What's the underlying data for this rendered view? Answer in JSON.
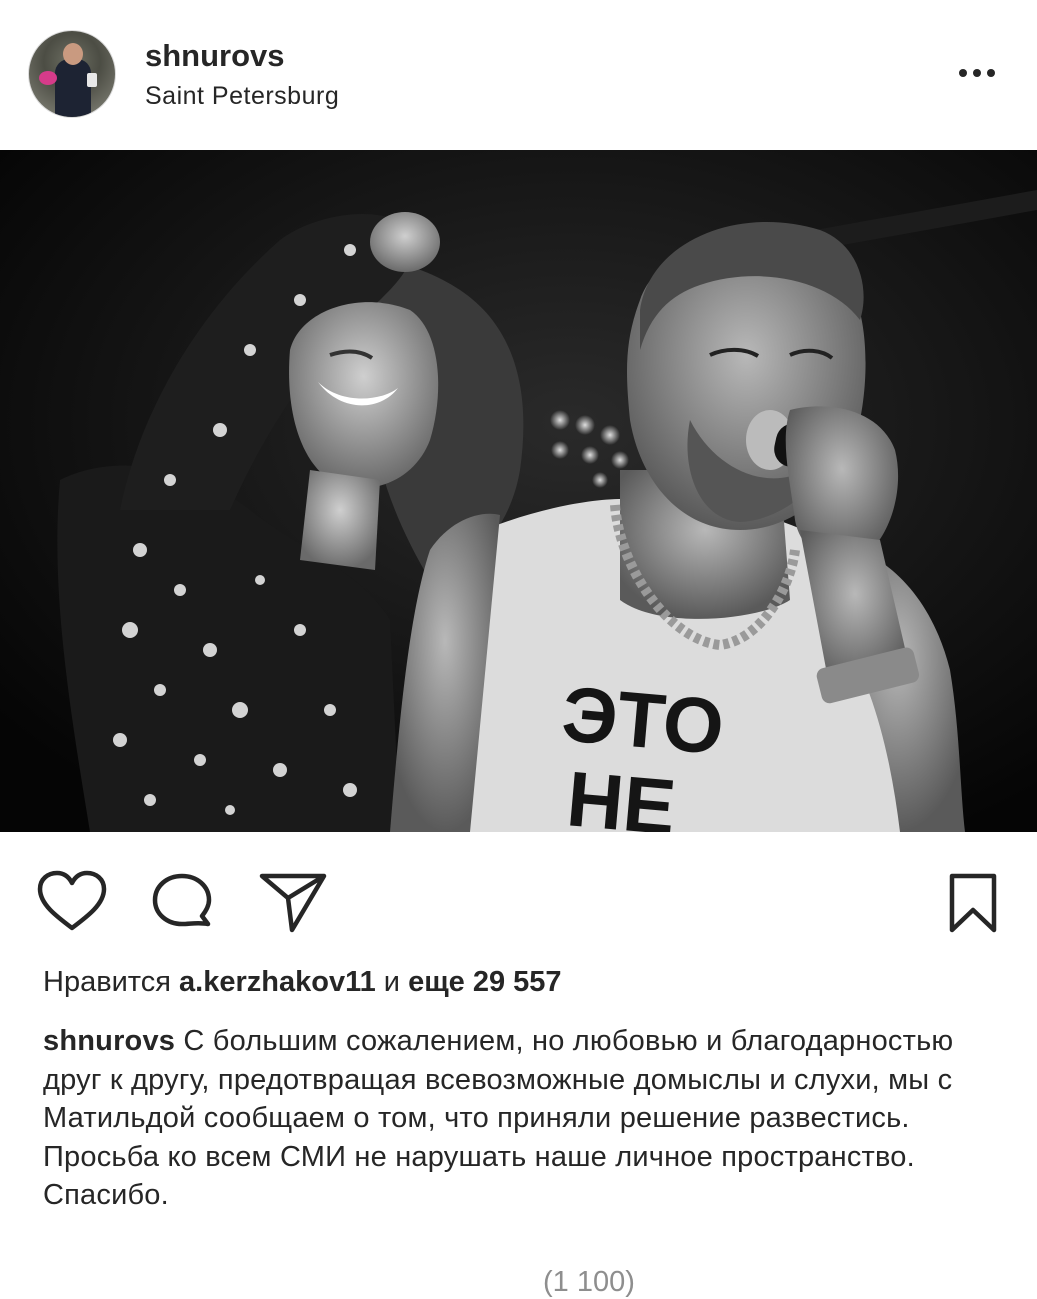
{
  "post": {
    "username": "shnurovs",
    "location": "Saint Petersburg",
    "photo_shirt_text_line1": "ЭТО",
    "photo_shirt_text_line2": "НЕ"
  },
  "likes": {
    "prefix": "Нравится",
    "user": "a.kerzhakov11",
    "middle": "и",
    "rest": "еще 29 557"
  },
  "caption": {
    "username": "shnurovs",
    "text": "С большим сожалением, но любовью и благодарностью друг к другу, предотвращая всевозможные домыслы и слухи, мы с Матильдой сообщаем о том, что приняли решение развестись. Просьба ко всем СМИ не нарушать наше личное пространство. Спасибо."
  },
  "comments": {
    "view_all_label": "(1 100)"
  },
  "icons": {
    "like": "heart-icon",
    "comment": "comment-icon",
    "share": "paper-plane-icon",
    "save": "bookmark-icon",
    "more": "more-options-icon"
  },
  "colors": {
    "text": "#262626",
    "muted": "#8e8e8e",
    "background": "#ffffff"
  }
}
